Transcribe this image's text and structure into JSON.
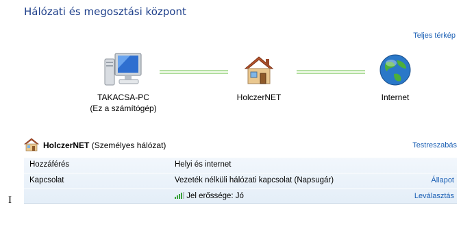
{
  "header": {
    "title": "Hálózati és megosztási központ",
    "full_map_link": "Teljes térkép"
  },
  "map": {
    "nodes": [
      {
        "label": "TAKACSA-PC",
        "sublabel": "(Ez a számítógép)",
        "icon": "computer-icon"
      },
      {
        "label": "HolczerNET",
        "icon": "house-network-icon"
      },
      {
        "label": "Internet",
        "icon": "globe-icon"
      }
    ],
    "connection_color": "#9fd68a"
  },
  "network": {
    "name": "HolczerNET",
    "type": "(Személyes hálózat)",
    "customize_link": "Testreszabás",
    "rows": [
      {
        "key": "Hozzáférés",
        "value": "Helyi és internet",
        "action": ""
      },
      {
        "key": "Kapcsolat",
        "value": "Vezeték nélküli hálózati kapcsolat (Napsugár)",
        "action": "Állapot"
      },
      {
        "key": "",
        "value": "Jel erőssége: Jó",
        "action": "Leválasztás",
        "icon": "signal-strength-icon"
      }
    ]
  },
  "cursor_glyph": "I",
  "colors": {
    "title": "#1e3f8a",
    "link": "#1a5fb4",
    "panel_top": "#f2f7fc",
    "panel_bottom": "#e4eef8"
  }
}
